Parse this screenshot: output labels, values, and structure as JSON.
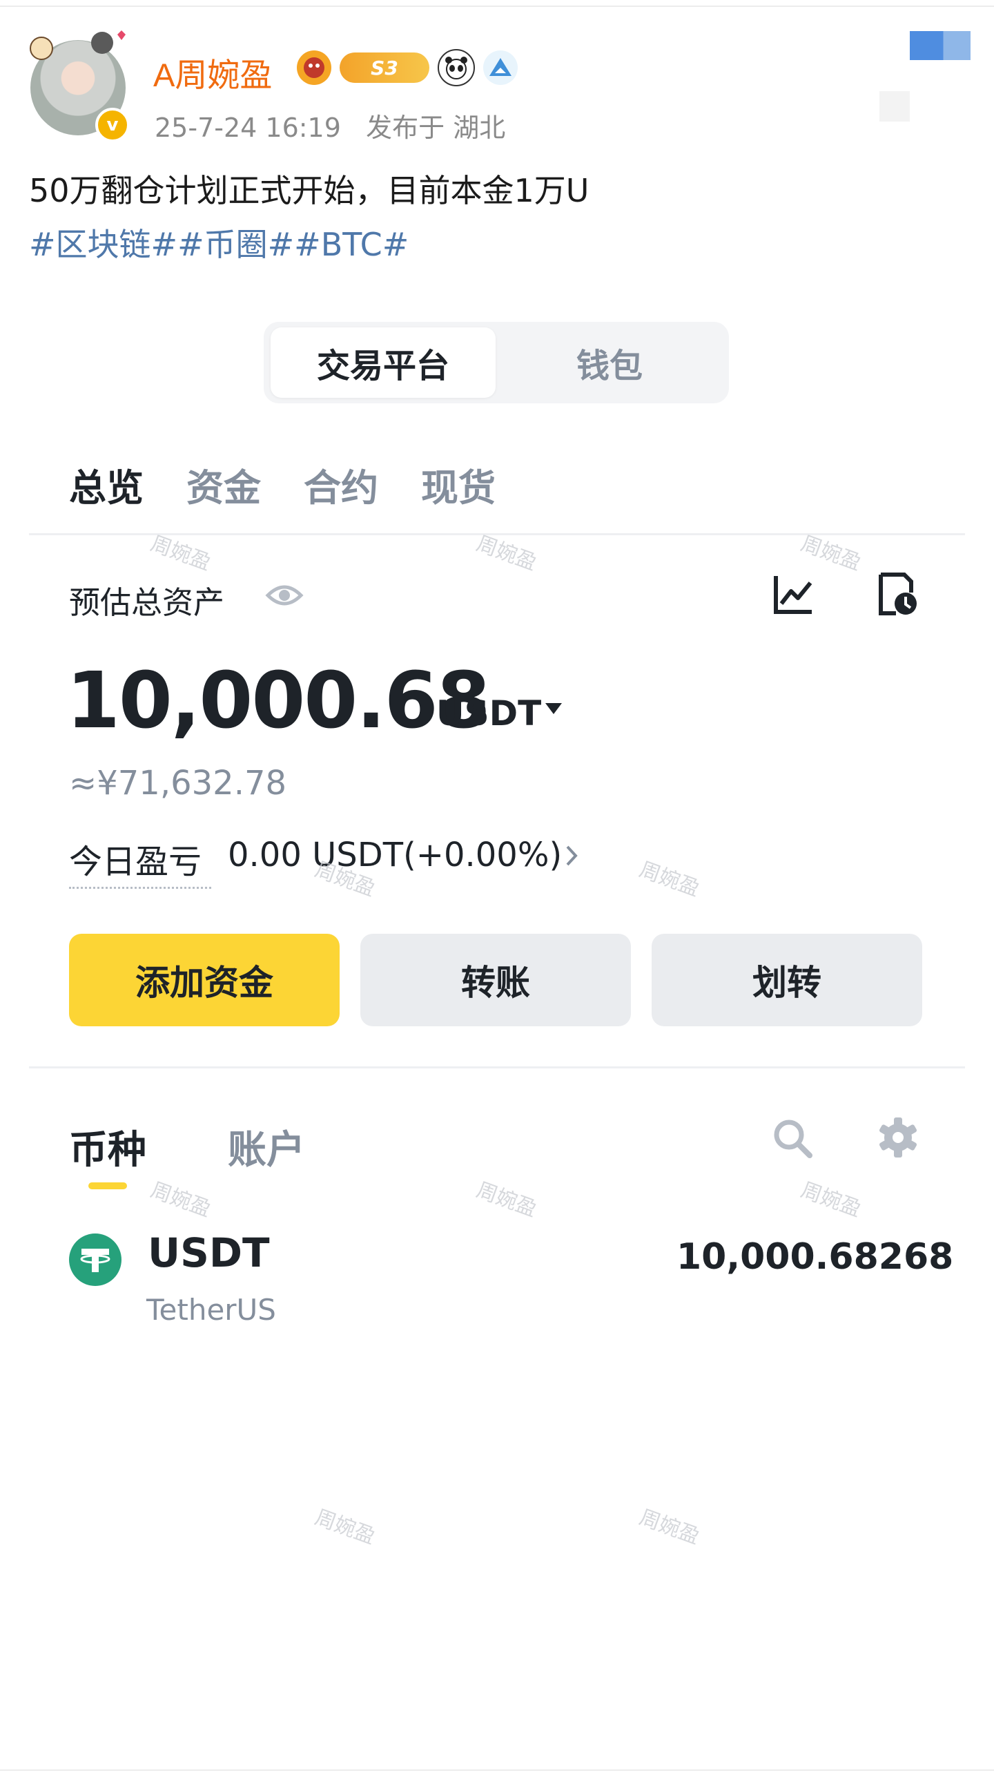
{
  "post": {
    "username": "A周婉盈",
    "badge_level": "S3",
    "timestamp": "25-7-24 16:19",
    "location": "发布于 湖北",
    "text": "50万翻仓计划正式开始，目前本金1万U",
    "tags": "#区块链##币圈##BTC#"
  },
  "segment": {
    "active": "交易平台",
    "inactive": "钱包"
  },
  "tabs": [
    "总览",
    "资金",
    "合约",
    "现货"
  ],
  "assets": {
    "label": "预估总资产",
    "total": "10,000.68",
    "unit": "USDT",
    "cny": "≈¥71,632.78",
    "pnl_label": "今日盈亏",
    "pnl_value": "0.00 USDT(+0.00%)"
  },
  "buttons": {
    "add_funds": "添加资金",
    "transfer": "转账",
    "internal_transfer": "划转"
  },
  "list": {
    "tab_coin": "币种",
    "tab_account": "账户",
    "items": [
      {
        "symbol": "USDT",
        "name": "TetherUS",
        "amount": "10,000.68268"
      }
    ]
  },
  "watermark": "周婉盈",
  "colors": {
    "accent": "#fcd535",
    "username": "#f06b10",
    "tag": "#4f78aa",
    "tether": "#26a17b"
  },
  "icons": [
    "eye-icon",
    "chart-icon",
    "history-icon",
    "search-icon",
    "gear-icon",
    "caret-down-icon",
    "chevron-right-icon",
    "tether-icon"
  ]
}
